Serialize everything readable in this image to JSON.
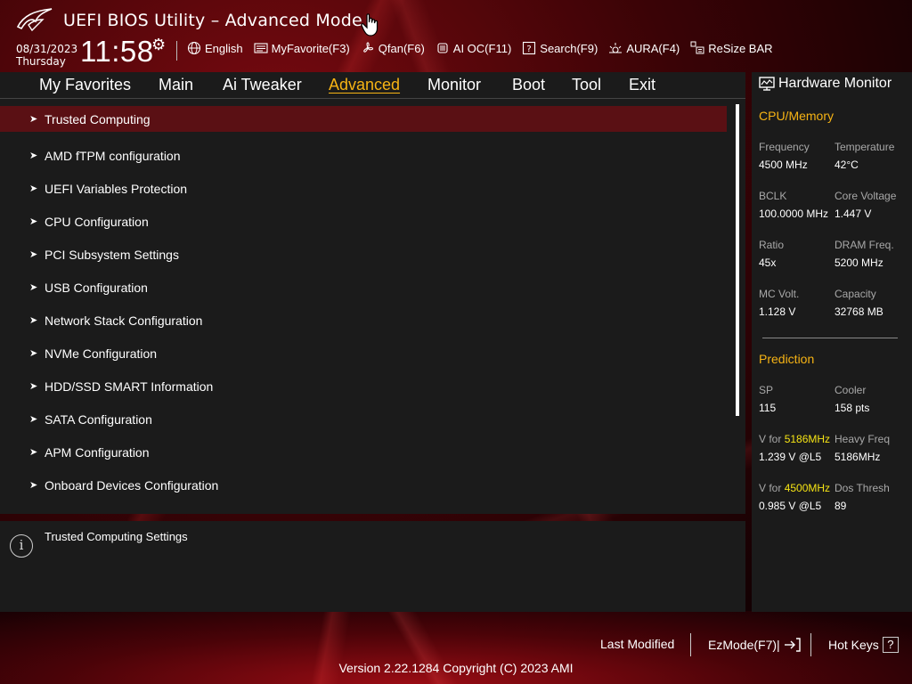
{
  "app": {
    "title": "UEFI BIOS Utility – Advanced Mode"
  },
  "header": {
    "date": "08/31/2023",
    "day": "Thursday",
    "time": "11:58",
    "toolbar": [
      {
        "label": "English",
        "icon": "globe-icon"
      },
      {
        "label": "MyFavorite(F3)",
        "icon": "favorite-icon"
      },
      {
        "label": "Qfan(F6)",
        "icon": "fan-icon"
      },
      {
        "label": "AI OC(F11)",
        "icon": "ai-chip-icon"
      },
      {
        "label": "Search(F9)",
        "icon": "search-icon"
      },
      {
        "label": "AURA(F4)",
        "icon": "aura-icon"
      },
      {
        "label": "ReSize BAR",
        "icon": "resize-bar-icon"
      }
    ]
  },
  "tabs": [
    "My Favorites",
    "Main",
    "Ai Tweaker",
    "Advanced",
    "Monitor",
    "Boot",
    "Tool",
    "Exit"
  ],
  "active_tab": "Advanced",
  "menu_items": [
    "Trusted Computing",
    "AMD fTPM configuration",
    "UEFI Variables Protection",
    "CPU Configuration",
    "PCI Subsystem Settings",
    "USB Configuration",
    "Network Stack Configuration",
    "NVMe Configuration",
    "HDD/SSD SMART Information",
    "SATA Configuration",
    "APM Configuration",
    "Onboard Devices Configuration"
  ],
  "selected_item": "Trusted Computing",
  "help": {
    "text": "Trusted Computing Settings"
  },
  "hardware_monitor": {
    "title": "Hardware Monitor",
    "cpu_memory": {
      "heading": "CPU/Memory",
      "frequency_label": "Frequency",
      "frequency": "4500 MHz",
      "temperature_label": "Temperature",
      "temperature": "42°C",
      "bclk_label": "BCLK",
      "bclk": "100.0000 MHz",
      "core_voltage_label": "Core Voltage",
      "core_voltage": "1.447 V",
      "ratio_label": "Ratio",
      "ratio": "45x",
      "dram_freq_label": "DRAM Freq.",
      "dram_freq": "5200 MHz",
      "mc_volt_label": "MC Volt.",
      "mc_volt": "1.128 V",
      "capacity_label": "Capacity",
      "capacity": "32768 MB"
    },
    "prediction": {
      "heading": "Prediction",
      "sp_label": "SP",
      "sp": "115",
      "cooler_label": "Cooler",
      "cooler": "158 pts",
      "v_for_label": "V for",
      "v_for_1_freq": "5186MHz",
      "v_for_1": "1.239 V @L5",
      "heavy_freq_label": "Heavy Freq",
      "heavy_freq": "5186MHz",
      "v_for_2_freq": "4500MHz",
      "v_for_2": "0.985 V @L5",
      "dos_thresh_label": "Dos Thresh",
      "dos_thresh": "89"
    }
  },
  "footer": {
    "last_modified": "Last Modified",
    "ezmode": "EzMode(F7)|",
    "hot_keys": "Hot Keys",
    "hot_keys_key": "?",
    "version": "Version 2.22.1284 Copyright (C) 2023 AMI"
  },
  "colors": {
    "accent": "#f6b314",
    "highlight_freq": "#f6e414",
    "selected_row": "#5a1014",
    "panel": "#1b1b1b"
  }
}
